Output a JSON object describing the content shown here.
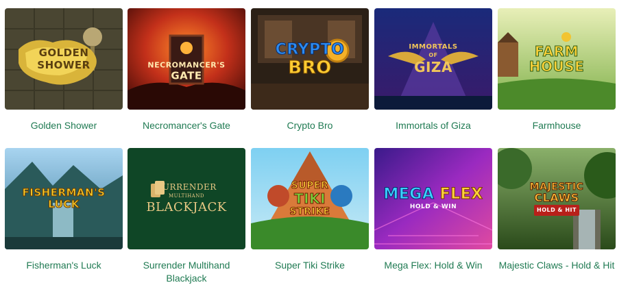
{
  "games": [
    {
      "id": "golden-shower",
      "title": "Golden Shower",
      "logo_lines": [
        "GOLDEN",
        "SHOWER"
      ]
    },
    {
      "id": "necromancers-gate",
      "title": "Necromancer's Gate",
      "logo_lines": [
        "NECROMANCER'S",
        "GATE"
      ]
    },
    {
      "id": "crypto-bro",
      "title": "Crypto Bro",
      "logo_lines": [
        "CRYPTO",
        "BRO"
      ]
    },
    {
      "id": "immortals-of-giza",
      "title": "Immortals of Giza",
      "logo_lines": [
        "IMMORTALS",
        "OF",
        "GIZA"
      ]
    },
    {
      "id": "farmhouse",
      "title": "Farmhouse",
      "logo_lines": [
        "FARM",
        "HOUSE"
      ]
    },
    {
      "id": "fishermans-luck",
      "title": "Fisherman's Luck",
      "logo_lines": [
        "FISHERMAN'S",
        "LUCK"
      ]
    },
    {
      "id": "surrender-multihand-blackjack",
      "title": "Surrender Multihand Blackjack",
      "logo_lines": [
        "SURRENDER",
        "MULTIHAND",
        "BLACKJACK"
      ]
    },
    {
      "id": "super-tiki-strike",
      "title": "Super Tiki Strike",
      "logo_lines": [
        "SUPER",
        "TIKI",
        "STRIKE"
      ]
    },
    {
      "id": "mega-flex",
      "title": "Mega Flex: Hold & Win",
      "logo_lines": [
        "MEGA",
        "FLEX",
        "HOLD & WIN"
      ]
    },
    {
      "id": "majestic-claws",
      "title": "Majestic Claws - Hold & Hit",
      "logo_lines": [
        "MAJESTIC",
        "CLAWS",
        "HOLD & HIT"
      ]
    }
  ],
  "colors": {
    "title": "#1f7a52",
    "background": "#ffffff"
  }
}
